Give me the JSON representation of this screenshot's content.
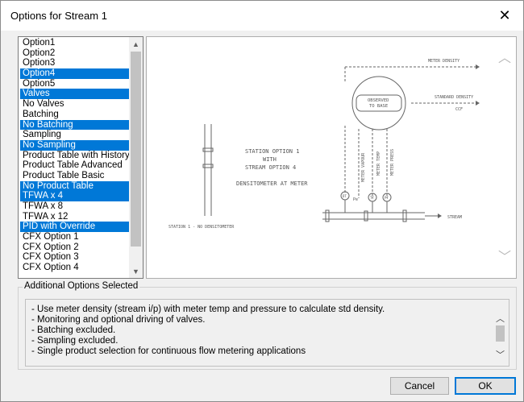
{
  "window": {
    "title": "Options for Stream 1",
    "close_glyph": "✕"
  },
  "options_list": {
    "items": [
      {
        "label": "Option1",
        "selected": false
      },
      {
        "label": "Option2",
        "selected": false
      },
      {
        "label": "Option3",
        "selected": false
      },
      {
        "label": "Option4",
        "selected": true
      },
      {
        "label": "Option5",
        "selected": false
      },
      {
        "label": "Valves",
        "selected": true
      },
      {
        "label": "No Valves",
        "selected": false
      },
      {
        "label": "Batching",
        "selected": false
      },
      {
        "label": "No Batching",
        "selected": true
      },
      {
        "label": "Sampling",
        "selected": false
      },
      {
        "label": "No Sampling",
        "selected": true
      },
      {
        "label": "Product Table with History",
        "selected": false
      },
      {
        "label": "Product Table Advanced",
        "selected": false
      },
      {
        "label": "Product Table Basic",
        "selected": false
      },
      {
        "label": "No Product Table",
        "selected": true
      },
      {
        "label": "TFWA x 4",
        "selected": true
      },
      {
        "label": "TFWA x 8",
        "selected": false
      },
      {
        "label": "TFWA x 12",
        "selected": false
      },
      {
        "label": "PID with Override",
        "selected": true
      },
      {
        "label": "CFX Option 1",
        "selected": false
      },
      {
        "label": "CFX Option 2",
        "selected": false
      },
      {
        "label": "CFX Option 3",
        "selected": false
      },
      {
        "label": "CFX Option 4",
        "selected": false
      }
    ],
    "selection_color": "#0078d7"
  },
  "diagram": {
    "meter_density": "METER DENSITY",
    "standard_density": "STANDARD DENSITY",
    "ccf": "CCF",
    "observed_line1": "OBSERVED",
    "observed_line2": "TO BASE",
    "station_line1": "STATION OPTION 1",
    "station_line2": "WITH",
    "station_line3": "STREAM OPTION 4",
    "densitometer": "DENSITOMETER AT METER",
    "meter_vapour": "METER VAPOUR",
    "meter_temp": "METER TEMP",
    "meter_press": "METER PRESS",
    "dt": "DT",
    "pe": "Pe",
    "tt": "TT",
    "pt": "PT",
    "stream": "STREAM",
    "station_note": "STATION 1 - NO DENSITOMETER"
  },
  "additional": {
    "label": "Additional Options Selected",
    "lines": [
      "- Use meter density (stream i/p) with meter temp and pressure to calculate std density.",
      "- Monitoring and optional driving of valves.",
      "- Batching excluded.",
      "- Sampling excluded.",
      "- Single product selection for continuous flow metering applications"
    ]
  },
  "buttons": {
    "cancel": "Cancel",
    "ok": "OK"
  }
}
